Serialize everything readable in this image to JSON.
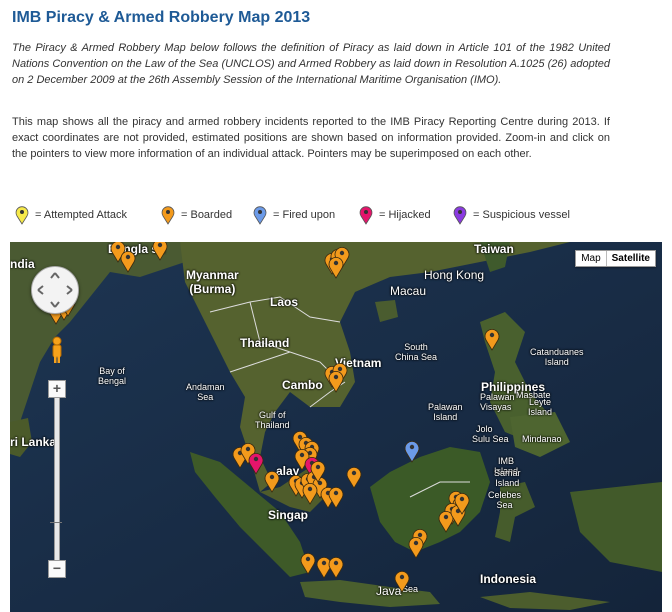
{
  "page": {
    "title": "IMB Piracy & Armed Robbery Map 2013",
    "intro": "The Piracy & Armed Robbery Map below follows the definition of Piracy as laid down in Article 101 of the 1982 United Nations Convention on the Law of the Sea (UNCLOS) and Armed Robbery as laid down in Resolution A.1025 (26) adopted on 2 December 2009 at the 26th Assembly Session of the International Maritime Organisation (IMO).",
    "description": "This map shows all the piracy and armed robbery incidents reported to the IMB Piracy Reporting Centre during 2013. If exact coordinates are not provided, estimated positions are shown based on information provided. Zoom-in and click on the pointers to view more information of an individual attack. Pointers may be superimposed on each other."
  },
  "legend": [
    {
      "label": "= Attempted Attack",
      "color": "#f6e94a"
    },
    {
      "label": "= Boarded",
      "color": "#f39a1c"
    },
    {
      "label": "= Fired upon",
      "color": "#6b9ae8"
    },
    {
      "label": "= Hijacked",
      "color": "#e5156b"
    },
    {
      "label": "= Suspicious vessel",
      "color": "#8a3ae0"
    }
  ],
  "map": {
    "type_buttons": {
      "map": "Map",
      "satellite": "Satellite"
    },
    "zoom_in": "+",
    "zoom_out": "−",
    "places": {
      "bangladesh": "Bangla    sh",
      "india": "ndia",
      "myanmar": "Myanmar\n(Burma)",
      "laos": "Laos",
      "thailand": "Thailand",
      "vietnam": "Vietnam",
      "cambodia": "Cambo",
      "hong_kong": "Hong Kong",
      "macau": "Macau",
      "taiwan": "Taiwan",
      "philippines": "Philippines",
      "sri_lanka": "ri Lanka",
      "malaysia": "alay",
      "singapore": "Singap",
      "indonesia": "Indonesia",
      "java": "Java"
    },
    "seas": {
      "bay_of_bengal": "Bay of\nBengal",
      "andaman_sea": "Andaman\nSea",
      "gulf_of_thailand": "Gulf of\nThailand",
      "south_china_sea": "South\nChina Sea",
      "sulu_sea": "Sulu Sea",
      "celebes_sea": "Celebes\nSea",
      "java_sea": "Sea",
      "catanduanes": "Catanduanes\nIsland",
      "masbate": "Masbate",
      "visayas": "Visayas",
      "leyte": "Leyte\nIsland",
      "palawan": "Palawan\nIsland",
      "palawan2": "Palawan",
      "mindanao": "Mindanao",
      "imb_island": "IMB\nIsland",
      "samar": "Samar\nIsland",
      "jolo": "Jolo"
    },
    "marker_type_counts": {
      "boarded": 44,
      "hijacked": 2,
      "fired_upon": 1
    }
  }
}
